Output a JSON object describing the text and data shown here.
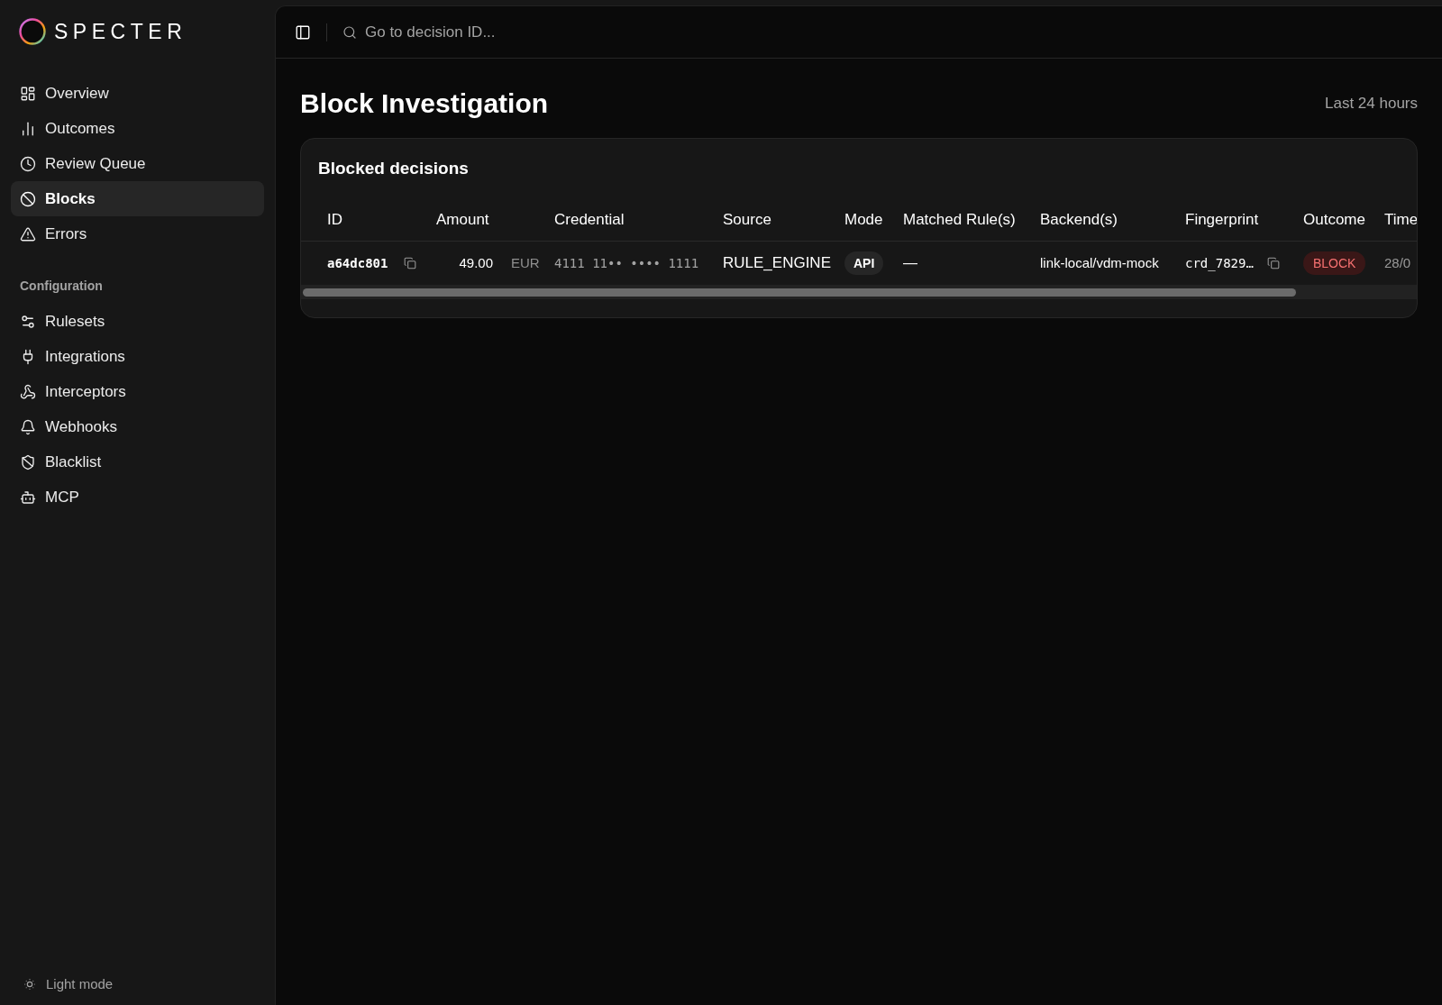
{
  "sidebar": {
    "brand": "SPECTER",
    "sections": [
      {
        "items": [
          {
            "label": "Overview",
            "selected": false
          },
          {
            "label": "Outcomes",
            "selected": false
          },
          {
            "label": "Review Queue",
            "selected": false
          },
          {
            "label": "Blocks",
            "selected": true
          },
          {
            "label": "Errors",
            "selected": false
          }
        ]
      },
      {
        "label": "Configuration",
        "items": [
          {
            "label": "Rulesets",
            "selected": false
          },
          {
            "label": "Integrations",
            "selected": false
          },
          {
            "label": "Interceptors",
            "selected": false
          },
          {
            "label": "Webhooks",
            "selected": false
          },
          {
            "label": "Blacklist",
            "selected": false
          },
          {
            "label": "MCP",
            "selected": false
          }
        ]
      }
    ],
    "theme_toggle": "Light mode"
  },
  "topbar": {
    "search": {
      "placeholder": "Go to decision ID..."
    }
  },
  "page": {
    "title": "Block Investigation",
    "range": "Last 24 hours"
  },
  "table": {
    "title": "Blocked decisions",
    "columns": [
      "ID",
      "Amount",
      "Credential",
      "Source",
      "Mode",
      "Matched Rule(s)",
      "Backend(s)",
      "Fingerprint",
      "Outcome",
      "Time"
    ],
    "rows": [
      {
        "id": "a64dc801",
        "amount": "49.00",
        "currency": "EUR",
        "credential": "4111 11•• •••• 1111",
        "source": "RULE_ENGINE",
        "mode": "API",
        "matched_rules": "—",
        "backends": "link-local/vdm-mock",
        "fingerprint": "crd_7829…",
        "outcome": "BLOCK",
        "time": "28/0"
      }
    ]
  }
}
